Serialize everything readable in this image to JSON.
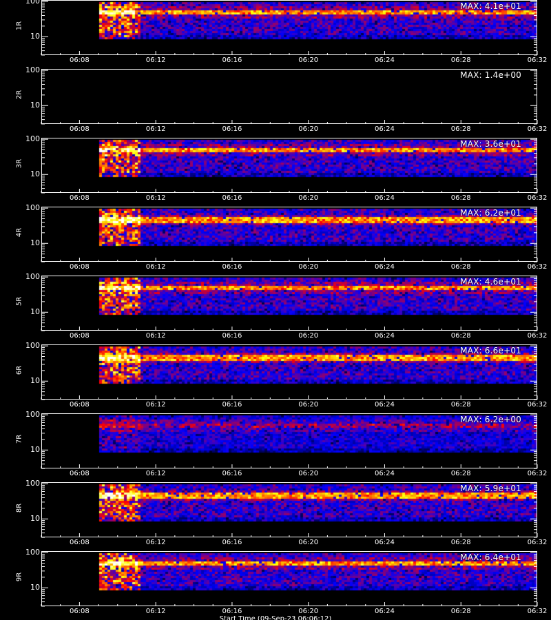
{
  "chart_data": {
    "type": "heatmap",
    "x_axis": {
      "ticks": [
        "06:08",
        "06:12",
        "06:16",
        "06:20",
        "06:24",
        "06:28",
        "06:32"
      ],
      "range": [
        "06:06",
        "06:32"
      ]
    },
    "y_axis": {
      "scale": "log",
      "ticks": [
        "10",
        "100"
      ],
      "range": [
        3,
        110
      ]
    },
    "data_start": "06:09",
    "colormap": [
      "#000000",
      "#0000ff",
      "#ff0000",
      "#ffff00",
      "#ffffff"
    ],
    "panels": [
      {
        "label": "1R",
        "max_label": "MAX: 4.1e+01",
        "max": 41
      },
      {
        "label": "2R",
        "max_label": "MAX: 1.4e+00",
        "max": 1.4
      },
      {
        "label": "3R",
        "max_label": "MAX: 3.6e+01",
        "max": 36
      },
      {
        "label": "4R",
        "max_label": "MAX: 6.2e+01",
        "max": 62
      },
      {
        "label": "5R",
        "max_label": "MAX: 4.6e+01",
        "max": 46
      },
      {
        "label": "6R",
        "max_label": "MAX: 6.6e+01",
        "max": 66
      },
      {
        "label": "7R",
        "max_label": "MAX: 6.2e+00",
        "max": 6.2
      },
      {
        "label": "8R",
        "max_label": "MAX: 5.9e+01",
        "max": 59
      },
      {
        "label": "9R",
        "max_label": "MAX: 6.4e+01",
        "max": 64
      }
    ],
    "footer": "Start Time (09-Sep-23 06:06:12)"
  }
}
